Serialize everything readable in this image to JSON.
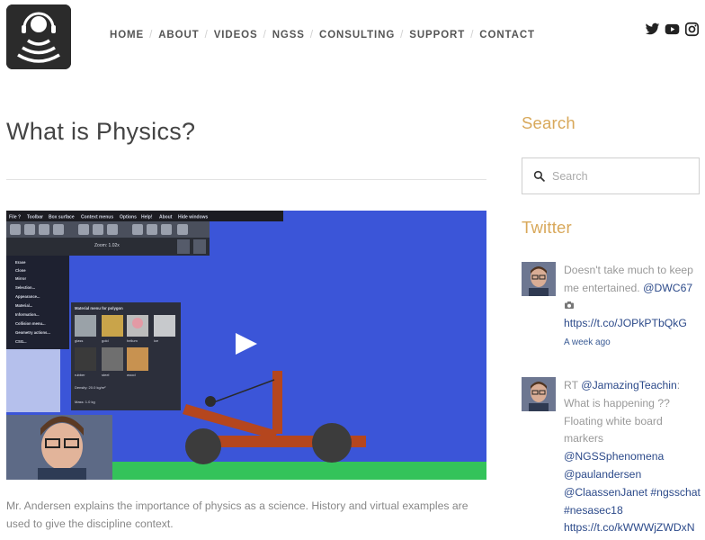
{
  "nav": [
    "HOME",
    "ABOUT",
    "VIDEOS",
    "NGSS",
    "CONSULTING",
    "SUPPORT",
    "CONTACT"
  ],
  "social": [
    "twitter-icon",
    "youtube-icon",
    "instagram-icon"
  ],
  "page": {
    "title": "What is Physics?",
    "caption": "Mr. Andersen explains the importance of physics as a science. History and virtual examples are used to give the discipline context."
  },
  "video": {
    "menu": [
      "File ?",
      "Toolbar",
      "Box surface",
      "Context menus",
      "Options",
      "Help!",
      "About",
      "Hide windows"
    ],
    "context_menu": [
      "Erase",
      "Clone",
      "Mirror",
      "Selection...",
      "Appearance...",
      "Material...",
      "Information...",
      "Collision menu...",
      "Geometry actions...",
      "CSG..."
    ],
    "zoom": "Zoom: 1.02x",
    "material_panel": {
      "title": "Material menu for polygon",
      "swatches": [
        "glass",
        "gold",
        "helium",
        "ice",
        "rubber",
        "steel",
        "wood"
      ],
      "density": "Density: 20.0 kg/m²",
      "mass": "Mass: 1.0 kg"
    }
  },
  "sidebar": {
    "search_heading": "Search",
    "search_placeholder": "Search",
    "twitter_heading": "Twitter",
    "tweets": [
      {
        "text": "Doesn't take much to keep me entertained.",
        "mention": "@DWC67",
        "url": "https://t.co/JOPkPTbQkG",
        "time": "A week ago"
      },
      {
        "prefix": "RT ",
        "mention": "@JamazingTeachin",
        "text": ": What is happening ?? Floating white board markers",
        "mentions": [
          "@NGSSphenomena",
          "@paulandersen",
          "@ClaassenJanet"
        ],
        "hashtags": [
          "#ngsschat",
          "#nesasec18"
        ],
        "url": "https://t.co/kWWWjZWDxN"
      }
    ]
  },
  "colors": {
    "accent": "#d8a85a",
    "link": "#2c4a8a",
    "video_bg": "#3b55d8"
  }
}
